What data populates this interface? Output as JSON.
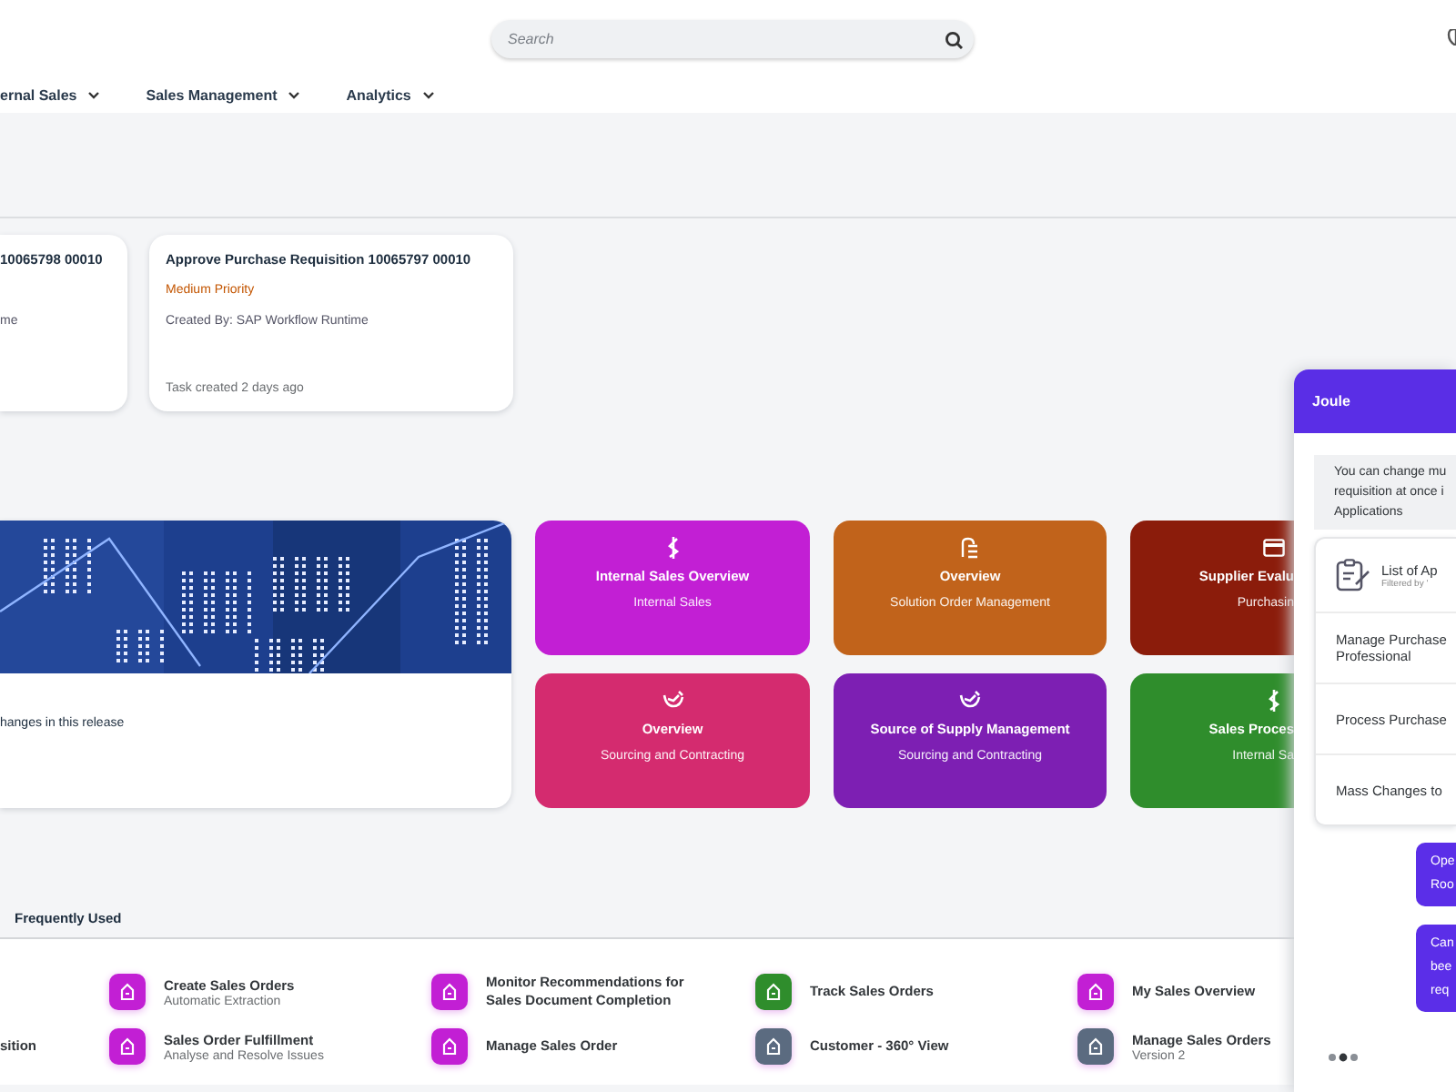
{
  "header": {
    "search": {
      "placeholder": "Search"
    },
    "nav": [
      {
        "label": "ernal Sales"
      },
      {
        "label": "Sales Management"
      },
      {
        "label": "Analytics"
      }
    ]
  },
  "tasks": [
    {
      "title": "10065798 00010",
      "created_by": "me"
    },
    {
      "title": "Approve Purchase Requisition 10065797 00010",
      "priority": "Medium Priority",
      "created_by": "Created By: SAP Workflow Runtime",
      "age": "Task created 2 days ago"
    }
  ],
  "news": {
    "text": "hanges in this release"
  },
  "tiles": [
    {
      "title": "Internal Sales Overview",
      "subtitle": "Internal Sales",
      "color": "#c21fd4",
      "kind": "dollar"
    },
    {
      "title": "Overview",
      "subtitle": "Solution Order Management",
      "color": "#c1631b",
      "kind": "document"
    },
    {
      "title": "Supplier Evalu",
      "subtitle": "Purchasin",
      "color": "#8b1c0b",
      "kind": "card"
    },
    {
      "title": "Overview",
      "subtitle": "Sourcing and Contracting",
      "color": "#d42b6f",
      "kind": "handshake"
    },
    {
      "title": "Source of Supply Management",
      "subtitle": "Sourcing and Contracting",
      "color": "#7d1fb3",
      "kind": "handshake"
    },
    {
      "title": "Sales Proces",
      "subtitle": "Internal Sa",
      "color": "#2f8d2c",
      "kind": "dollar"
    }
  ],
  "frequently_used": {
    "title": "Frequently Used",
    "items": [
      {
        "title": "sition"
      },
      {
        "title": "Create Sales Orders",
        "subtitle": "Automatic Extraction",
        "color": "#c21fd4"
      },
      {
        "title": "Sales Order Fulfillment",
        "subtitle": "Analyse and Resolve Issues",
        "color": "#c21fd4"
      },
      {
        "title": "Monitor Recommendations for Sales Document Completion",
        "color": "#c21fd4"
      },
      {
        "title": "Manage Sales Order",
        "color": "#c21fd4"
      },
      {
        "title": "Track Sales Orders",
        "color": "#2f8d2c"
      },
      {
        "title": "Customer - 360° View",
        "color": "#5b6b80"
      },
      {
        "title": "My Sales Overview",
        "color": "#c21fd4"
      },
      {
        "title": "Manage Sales Orders",
        "subtitle": "Version 2",
        "color": "#5b6b80"
      }
    ]
  },
  "joule": {
    "title": "Joule",
    "message": [
      "You can change mu",
      "requisition at once i",
      "Applications"
    ],
    "results": [
      {
        "kind": "app",
        "title": "List of Ap",
        "subtitle": "Filtered by '"
      },
      {
        "kind": "link",
        "lines": [
          "Manage Purchase",
          "Professional"
        ]
      },
      {
        "kind": "link",
        "lines": [
          "Process Purchase"
        ]
      },
      {
        "kind": "link",
        "lines": [
          "Mass Changes to"
        ]
      }
    ],
    "bubbles": [
      [
        "Ope",
        "Roo"
      ],
      [
        "Can",
        "bee",
        "req"
      ]
    ]
  }
}
